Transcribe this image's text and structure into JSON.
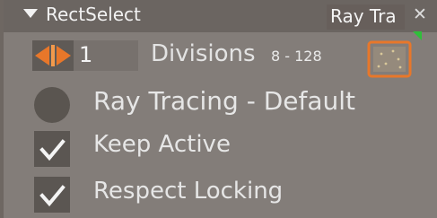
{
  "panel": {
    "title": "RectSelect",
    "tab_label": "Ray Tra",
    "close_glyph": "✕"
  },
  "divisions": {
    "value": "1",
    "label": "Divisions",
    "range": "8 - 128"
  },
  "mode_option": {
    "label": "Ray Tracing - Default",
    "selected": false
  },
  "options": [
    {
      "label": "Keep Active",
      "checked": true
    },
    {
      "label": "Respect Locking",
      "checked": true
    }
  ],
  "colors": {
    "accent": "#e8772a",
    "indicator": "#2fbf3a"
  },
  "icons": {
    "collapse": "collapse-arrow-icon",
    "spinner": "spinner-arrows-icon",
    "preview": "scatter-preview-icon",
    "close": "close-icon",
    "check": "checkmark-icon"
  }
}
